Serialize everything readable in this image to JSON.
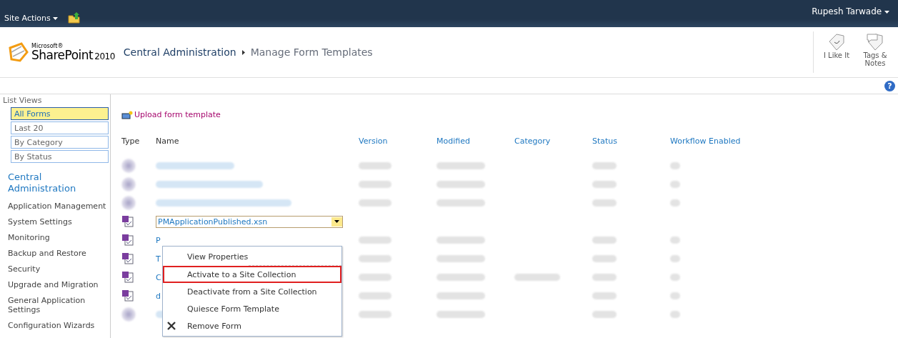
{
  "top_bar": {
    "site_actions": "Site Actions",
    "user": "Rupesh Tarwade"
  },
  "header": {
    "logo_small": "Microsoft®",
    "logo_main": "SharePoint",
    "logo_year": "2010",
    "breadcrumb": [
      "Central Administration",
      "Manage Form Templates"
    ],
    "actions": [
      "I Like It",
      "Tags & Notes"
    ],
    "help": "?"
  },
  "sidebar": {
    "list_views_title": "List Views",
    "views": [
      {
        "label": "All Forms",
        "selected": true
      },
      {
        "label": "Last 20",
        "selected": false
      },
      {
        "label": "By Category",
        "selected": false
      },
      {
        "label": "By Status",
        "selected": false
      }
    ],
    "heading": "Central Administration",
    "links": [
      "Application Management",
      "System Settings",
      "Monitoring",
      "Backup and Restore",
      "Security",
      "Upgrade and Migration",
      "General Application Settings",
      "Configuration Wizards"
    ]
  },
  "toolbar": {
    "upload": "Upload form template"
  },
  "table": {
    "columns": [
      "Type",
      "Name",
      "Version",
      "Modified",
      "Category",
      "Status",
      "Workflow Enabled"
    ],
    "rows": [
      {
        "kind": "hidden",
        "category_blurred": false
      },
      {
        "kind": "hidden",
        "category_blurred": false
      },
      {
        "kind": "hidden",
        "category_blurred": false
      },
      {
        "kind": "form",
        "name": "PMApplicationPublished.xsn",
        "selected": true,
        "category_blurred": false
      },
      {
        "kind": "form",
        "name": "P",
        "selected": false,
        "category_blurred": false
      },
      {
        "kind": "form",
        "name": "T",
        "selected": false,
        "category_blurred": false
      },
      {
        "kind": "form",
        "name": "C",
        "selected": false,
        "category_blurred": true
      },
      {
        "kind": "form",
        "name": "d",
        "selected": false,
        "category_blurred": false
      },
      {
        "kind": "hidden",
        "category_blurred": false
      }
    ]
  },
  "context_menu": {
    "items": [
      {
        "label": "View Properties",
        "kind": "plain",
        "highlighted": false
      },
      {
        "label": "Activate to a Site Collection",
        "kind": "plain",
        "highlighted": true
      },
      {
        "label": "Deactivate from a Site Collection",
        "kind": "plain",
        "highlighted": false
      },
      {
        "label": "Quiesce Form Template",
        "kind": "plain",
        "highlighted": false
      },
      {
        "label": "Remove Form",
        "kind": "remove",
        "highlighted": false
      }
    ]
  }
}
